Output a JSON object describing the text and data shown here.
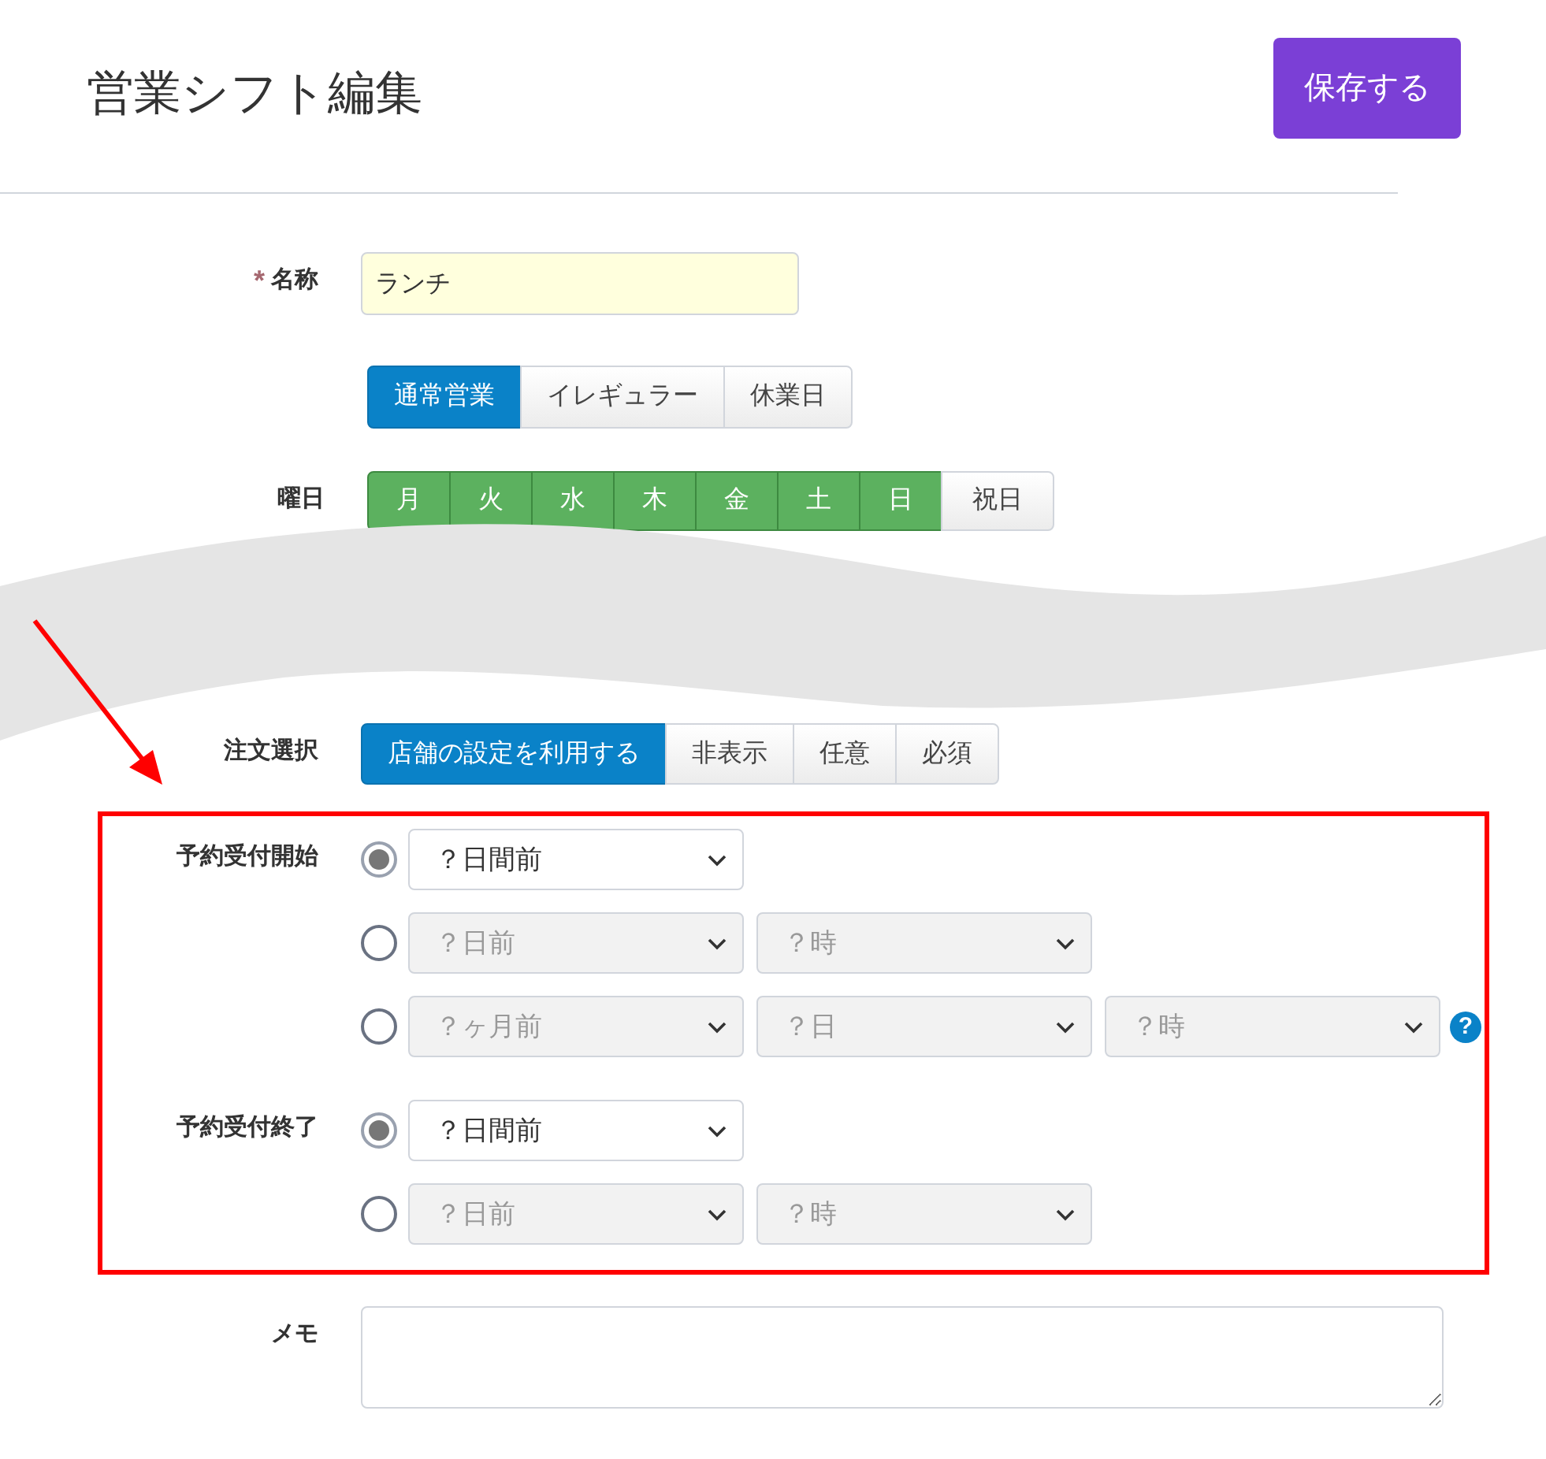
{
  "page_title": "営業シフト編集",
  "save_button": "保存する",
  "name_field": {
    "label": "名称",
    "required": true,
    "required_mark": "*",
    "value": "ランチ"
  },
  "business_type": [
    {
      "label": "通常営業",
      "selected": true
    },
    {
      "label": "イレギュラー",
      "selected": false
    },
    {
      "label": "休業日",
      "selected": false
    }
  ],
  "weekdays": {
    "label": "曜日",
    "days": [
      {
        "label": "月",
        "selected": true
      },
      {
        "label": "火",
        "selected": true
      },
      {
        "label": "水",
        "selected": true
      },
      {
        "label": "木",
        "selected": true
      },
      {
        "label": "金",
        "selected": true
      },
      {
        "label": "土",
        "selected": true
      },
      {
        "label": "日",
        "selected": true
      },
      {
        "label": "祝日",
        "selected": false
      }
    ]
  },
  "order_selection": {
    "label": "注文選択",
    "options": [
      {
        "label": "店舗の設定を利用する",
        "selected": true
      },
      {
        "label": "非表示",
        "selected": false
      },
      {
        "label": "任意",
        "selected": false
      },
      {
        "label": "必須",
        "selected": false
      }
    ]
  },
  "reservation_start": {
    "label": "予約受付開始",
    "options": [
      {
        "selected": true,
        "selects": [
          {
            "value": "？日間前",
            "disabled": false
          }
        ]
      },
      {
        "selected": false,
        "selects": [
          {
            "value": "？日前",
            "disabled": true
          },
          {
            "value": "？時",
            "disabled": true
          }
        ]
      },
      {
        "selected": false,
        "selects": [
          {
            "value": "？ヶ月前",
            "disabled": true
          },
          {
            "value": "？日",
            "disabled": true
          },
          {
            "value": "？時",
            "disabled": true
          }
        ],
        "help": "?"
      }
    ]
  },
  "reservation_end": {
    "label": "予約受付終了",
    "options": [
      {
        "selected": true,
        "selects": [
          {
            "value": "？日間前",
            "disabled": false
          }
        ]
      },
      {
        "selected": false,
        "selects": [
          {
            "value": "？日前",
            "disabled": true
          },
          {
            "value": "？時",
            "disabled": true
          }
        ]
      }
    ]
  },
  "memo": {
    "label": "メモ"
  }
}
